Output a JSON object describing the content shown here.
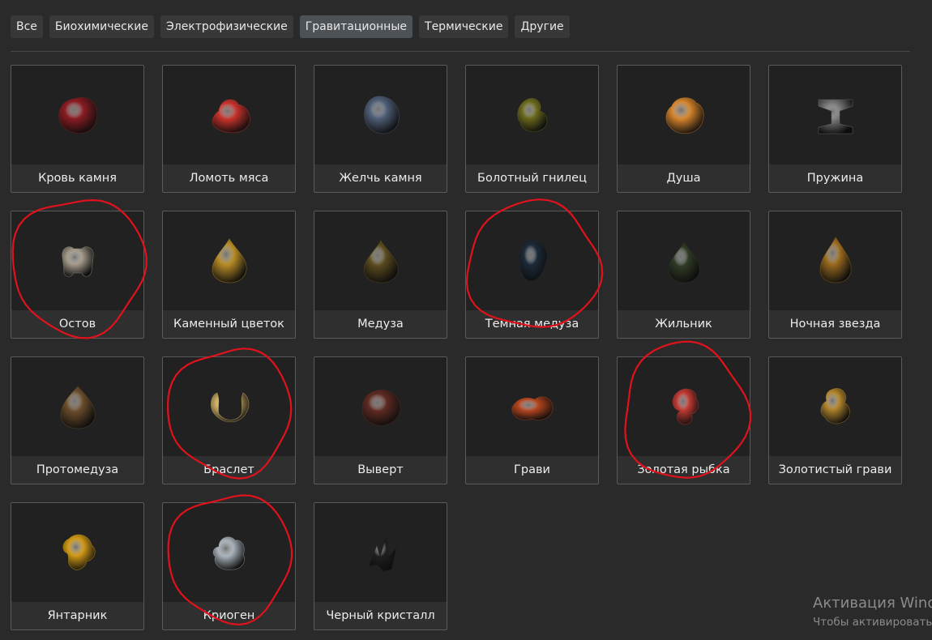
{
  "tabs": [
    {
      "label": "Все",
      "active": false
    },
    {
      "label": "Биохимические",
      "active": false
    },
    {
      "label": "Электрофизические",
      "active": false
    },
    {
      "label": "Гравитационные",
      "active": true
    },
    {
      "label": "Термические",
      "active": false
    },
    {
      "label": "Другие",
      "active": false
    }
  ],
  "artifacts": [
    {
      "name": "Кровь камня",
      "icon": "stone-blood-artifact-icon",
      "color": "#8a1c22",
      "highlighted": false
    },
    {
      "name": "Ломоть мяса",
      "icon": "meat-chunk-artifact-icon",
      "color": "#c8322b",
      "highlighted": false
    },
    {
      "name": "Желчь камня",
      "icon": "stone-bile-artifact-icon",
      "color": "#4f5f78",
      "highlighted": false
    },
    {
      "name": "Болотный гнилец",
      "icon": "swamp-rot-artifact-icon",
      "color": "#6b6a1d",
      "highlighted": false
    },
    {
      "name": "Душа",
      "icon": "soul-artifact-icon",
      "color": "#d6842b",
      "highlighted": false
    },
    {
      "name": "Пружина",
      "icon": "spring-artifact-icon",
      "color": "#7a7a7a",
      "highlighted": false
    },
    {
      "name": "Остов",
      "icon": "frame-artifact-icon",
      "color": "#a49a8a",
      "highlighted": true
    },
    {
      "name": "Каменный цветок",
      "icon": "stone-flower-artifact-icon",
      "color": "#b58a24",
      "highlighted": false
    },
    {
      "name": "Медуза",
      "icon": "jellyfish-artifact-icon",
      "color": "#5a4a1e",
      "highlighted": false
    },
    {
      "name": "Темная медуза",
      "icon": "dark-jellyfish-artifact-icon",
      "color": "#1c2a38",
      "highlighted": true
    },
    {
      "name": "Жильник",
      "icon": "vein-artifact-icon",
      "color": "#2f3a25",
      "highlighted": false
    },
    {
      "name": "Ночная звезда",
      "icon": "night-star-artifact-icon",
      "color": "#9a6a1e",
      "highlighted": false
    },
    {
      "name": "Протомедуза",
      "icon": "protojellyfish-artifact-icon",
      "color": "#6a4c2a",
      "highlighted": false
    },
    {
      "name": "Браслет",
      "icon": "bracelet-artifact-icon",
      "color": "#d9b86a",
      "highlighted": true
    },
    {
      "name": "Выверт",
      "icon": "twist-artifact-icon",
      "color": "#5e2a22",
      "highlighted": false
    },
    {
      "name": "Грави",
      "icon": "gravi-artifact-icon",
      "color": "#b5461f",
      "highlighted": false
    },
    {
      "name": "Золотая рыбка",
      "icon": "goldfish-artifact-icon",
      "color": "#c23a33",
      "highlighted": true
    },
    {
      "name": "Золотистый грави",
      "icon": "golden-gravi-artifact-icon",
      "color": "#b2852c",
      "highlighted": false
    },
    {
      "name": "Янтарник",
      "icon": "amber-artifact-icon",
      "color": "#d29a16",
      "highlighted": false
    },
    {
      "name": "Криоген",
      "icon": "cryogen-artifact-icon",
      "color": "#a9b2bb",
      "highlighted": true
    },
    {
      "name": "Черный кристалл",
      "icon": "black-crystal-artifact-icon",
      "color": "#1e1e1e",
      "highlighted": false
    }
  ],
  "annotation_color": "#e0121c",
  "watermark": {
    "line1": "Активация Windows",
    "line2": "Чтобы активировать Windows, перейдите в раздел «Параметры»."
  }
}
